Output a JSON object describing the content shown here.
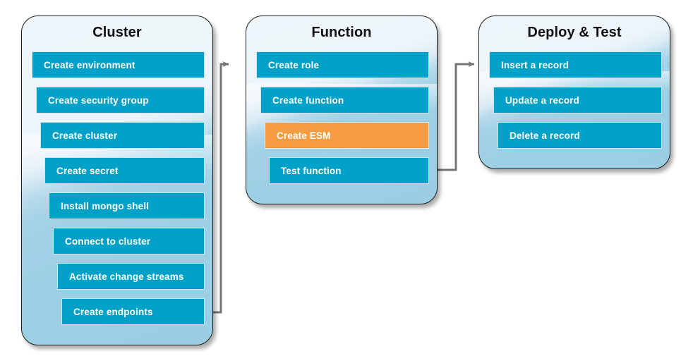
{
  "diagram": {
    "title": "Cluster / Function / Deploy & Test workflow",
    "colors": {
      "step_blue": "#00A1C9",
      "step_highlight_orange": "#F89C42",
      "panel_light": "#EFF6FB",
      "panel_dark": "#9BCEE3",
      "connector_gray": "#757575",
      "title_text": "#111111",
      "step_text": "#FFFFFF"
    },
    "panels": [
      {
        "id": "cluster",
        "title": "Cluster",
        "steps": [
          {
            "label": "Create environment",
            "highlighted": false
          },
          {
            "label": "Create security group",
            "highlighted": false
          },
          {
            "label": "Create cluster",
            "highlighted": false
          },
          {
            "label": "Create secret",
            "highlighted": false
          },
          {
            "label": "Install mongo shell",
            "highlighted": false
          },
          {
            "label": "Connect to cluster",
            "highlighted": false
          },
          {
            "label": "Activate change streams",
            "highlighted": false
          },
          {
            "label": "Create endpoints",
            "highlighted": false
          }
        ]
      },
      {
        "id": "function",
        "title": "Function",
        "steps": [
          {
            "label": "Create role",
            "highlighted": false
          },
          {
            "label": "Create function",
            "highlighted": false
          },
          {
            "label": "Create ESM",
            "highlighted": true
          },
          {
            "label": "Test function",
            "highlighted": false
          }
        ]
      },
      {
        "id": "deploy-test",
        "title": "Deploy & Test",
        "steps": [
          {
            "label": "Insert a record",
            "highlighted": false
          },
          {
            "label": "Update a record",
            "highlighted": false
          },
          {
            "label": "Delete a record",
            "highlighted": false
          }
        ]
      }
    ],
    "connectors": [
      {
        "id": "cluster-to-function",
        "from": "cluster",
        "to": "function",
        "arrow": "right"
      },
      {
        "id": "function-to-deploy-test",
        "from": "function",
        "to": "deploy-test",
        "arrow": "right"
      }
    ]
  }
}
